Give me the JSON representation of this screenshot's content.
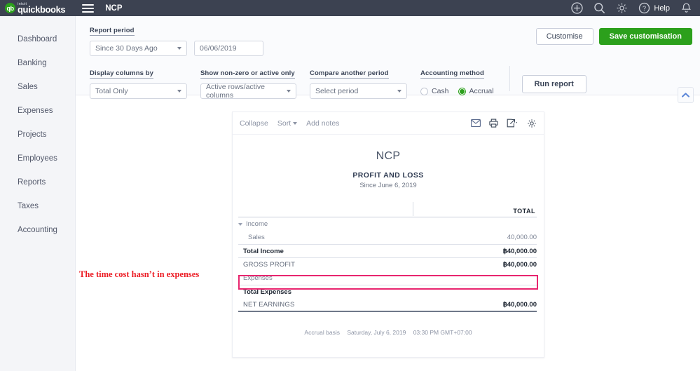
{
  "topbar": {
    "logo_intuit": "intuit",
    "logo_name": "quickbooks",
    "company": "NCP",
    "help_label": "Help",
    "icons": [
      "plus-icon",
      "search-icon",
      "gear-icon",
      "help-icon",
      "bell-icon"
    ]
  },
  "sidebar": {
    "items": [
      {
        "label": "Dashboard"
      },
      {
        "label": "Banking"
      },
      {
        "label": "Sales"
      },
      {
        "label": "Expenses"
      },
      {
        "label": "Projects"
      },
      {
        "label": "Employees"
      },
      {
        "label": "Reports"
      },
      {
        "label": "Taxes"
      },
      {
        "label": "Accounting"
      }
    ]
  },
  "filters": {
    "report_period": {
      "label": "Report period",
      "select_value": "Since 30 Days Ago",
      "date_value": "06/06/2019"
    },
    "display_columns": {
      "label": "Display columns by",
      "value": "Total Only"
    },
    "show_nonzero": {
      "label": "Show non-zero or active only",
      "value": "Active rows/active columns"
    },
    "compare_period": {
      "label": "Compare another period",
      "value": "Select period"
    },
    "accounting_method": {
      "label": "Accounting method",
      "cash_label": "Cash",
      "accrual_label": "Accrual",
      "selected": "Accrual"
    },
    "run_report_label": "Run report",
    "customise_label": "Customise",
    "save_customisation_label": "Save customisation"
  },
  "report_toolbar": {
    "collapse_label": "Collapse",
    "sort_label": "Sort",
    "add_notes_label": "Add notes",
    "icons": [
      "email-icon",
      "print-icon",
      "export-icon",
      "settings-icon"
    ]
  },
  "report": {
    "company": "NCP",
    "title": "PROFIT AND LOSS",
    "subtitle": "Since June 6, 2019",
    "column_header": "TOTAL",
    "rows": [
      {
        "label": "Income",
        "value": "",
        "type": "section"
      },
      {
        "label": "Sales",
        "value": "40,000.00",
        "type": "detail"
      },
      {
        "label": "Total Income",
        "value": "฿40,000.00",
        "type": "total"
      },
      {
        "label": "GROSS PROFIT",
        "value": "฿40,000.00",
        "type": "gross"
      },
      {
        "label": "Expenses",
        "value": "",
        "type": "section-empty"
      },
      {
        "label": "Total Expenses",
        "value": "",
        "type": "totexp"
      },
      {
        "label": "NET EARNINGS",
        "value": "฿40,000.00",
        "type": "netearn"
      }
    ],
    "footer": {
      "basis": "Accrual basis",
      "date": "Saturday, July 6, 2019",
      "time": "03:30 PM GMT+07:00"
    }
  },
  "annotation": {
    "text": "The time cost hasn’t in expenses",
    "color": "#ec1c24",
    "highlight_color": "#e8256f"
  },
  "colors": {
    "topbar": "#3c4251",
    "brand_green": "#2ca01c",
    "sidebar_bg": "#f4f5f8",
    "accent_pink": "#e8256f"
  }
}
